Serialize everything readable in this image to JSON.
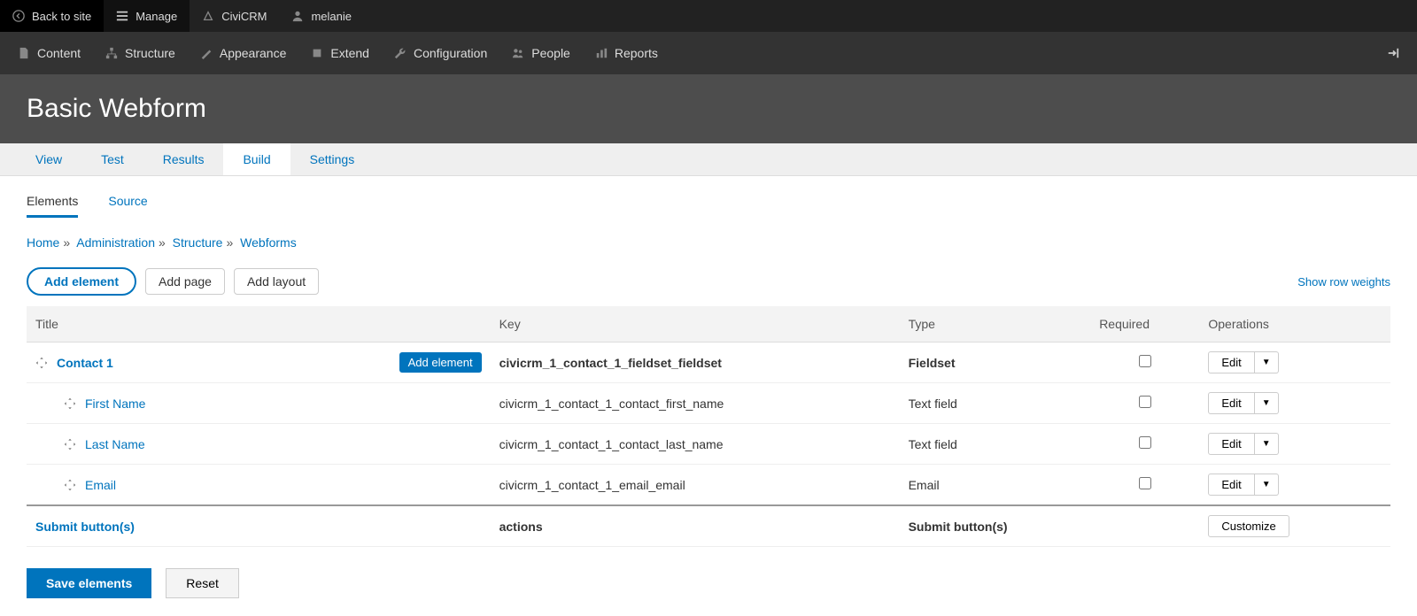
{
  "toolbar": {
    "back": "Back to site",
    "manage": "Manage",
    "civicrm": "CiviCRM",
    "user": "melanie"
  },
  "adminMenu": {
    "content": "Content",
    "structure": "Structure",
    "appearance": "Appearance",
    "extend": "Extend",
    "configuration": "Configuration",
    "people": "People",
    "reports": "Reports"
  },
  "pageTitle": "Basic Webform",
  "primaryTabs": {
    "view": "View",
    "test": "Test",
    "results": "Results",
    "build": "Build",
    "settings": "Settings"
  },
  "secondaryTabs": {
    "elements": "Elements",
    "source": "Source"
  },
  "breadcrumb": {
    "home": "Home",
    "administration": "Administration",
    "structure": "Structure",
    "webforms": "Webforms"
  },
  "buttons": {
    "addElement": "Add element",
    "addPage": "Add page",
    "addLayout": "Add layout",
    "showWeights": "Show row weights",
    "save": "Save elements",
    "reset": "Reset",
    "edit": "Edit",
    "customize": "Customize",
    "addElementRow": "Add element"
  },
  "tableHeaders": {
    "title": "Title",
    "key": "Key",
    "type": "Type",
    "required": "Required",
    "operations": "Operations"
  },
  "rows": [
    {
      "title": "Contact 1",
      "key": "civicrm_1_contact_1_fieldset_fieldset",
      "type": "Fieldset",
      "indent": 0,
      "bold": true,
      "addBtn": true
    },
    {
      "title": "First Name",
      "key": "civicrm_1_contact_1_contact_first_name",
      "type": "Text field",
      "indent": 1,
      "bold": false,
      "addBtn": false
    },
    {
      "title": "Last Name",
      "key": "civicrm_1_contact_1_contact_last_name",
      "type": "Text field",
      "indent": 1,
      "bold": false,
      "addBtn": false
    },
    {
      "title": "Email",
      "key": "civicrm_1_contact_1_email_email",
      "type": "Email",
      "indent": 1,
      "bold": false,
      "addBtn": false
    }
  ],
  "actionsRow": {
    "title": "Submit button(s)",
    "key": "actions",
    "type": "Submit button(s)"
  }
}
